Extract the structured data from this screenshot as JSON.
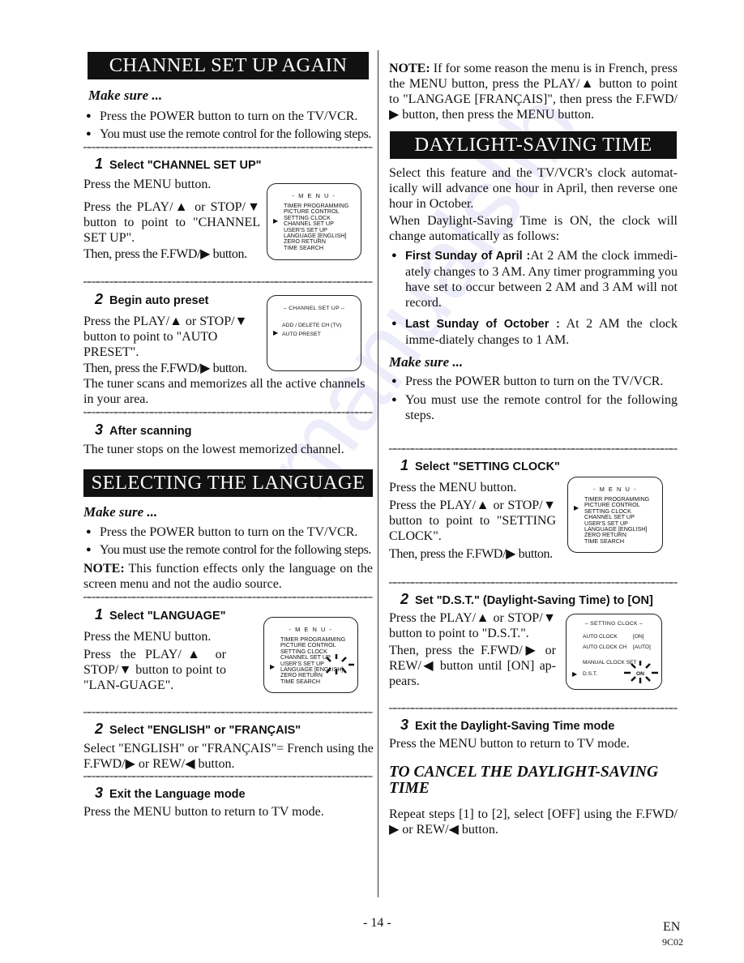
{
  "left_column": {
    "channel_setup": {
      "banner": "CHANNEL SET UP AGAIN",
      "make_sure": "Make sure ...",
      "bullets": [
        "Press the POWER button to turn on the TV/VCR.",
        "You must use the remote control for the following steps."
      ],
      "step1": {
        "number": "1",
        "title": "Select \"CHANNEL SET UP\"",
        "lines": [
          "Press  the MENU button.",
          "Press the PLAY/▲ or STOP/▼ button to point to \"CHANNEL SET UP\".",
          "Then, press the F.FWD/▶ button."
        ],
        "screen": {
          "title": "- M E N U -",
          "items": [
            "TIMER PROGRAMMING",
            "PICTURE CONTROL",
            "SETTING CLOCK",
            "CHANNEL SET UP",
            "USER'S SET UP",
            "LANGUAGE  [ENGLISH]",
            "ZERO RETURN",
            "TIME SEARCH"
          ],
          "cursor": "▶",
          "selected_index": 3
        }
      },
      "step2": {
        "number": "2",
        "title": "Begin auto preset",
        "lines": [
          "Press the PLAY/▲ or STOP/▼ button to point to \"AUTO PRESET\".",
          "Then, press the F.FWD/▶ button.",
          "The tuner scans and memorizes all the active channels in your area."
        ],
        "screen": {
          "title": "– CHANNEL  SET  UP –",
          "items": [
            "ADD / DELETE CH (TV)",
            "AUTO PRESET"
          ],
          "cursor": "▶",
          "selected_index": 1
        }
      },
      "step3": {
        "number": "3",
        "title": "After scanning",
        "text": "The tuner stops on the lowest memorized channel."
      }
    },
    "language": {
      "banner": "SELECTING THE LANGUAGE",
      "make_sure": "Make sure ...",
      "bullets": [
        "Press the POWER button to turn on the TV/VCR.",
        "You must use the remote control for the following steps."
      ],
      "note_label": "NOTE:",
      "note_text": " This function effects only the language on the screen menu and not the audio source.",
      "step1": {
        "number": "1",
        "title": "Select \"LANGUAGE\"",
        "lines": [
          "Press the MENU button.",
          "Press the PLAY/▲ or STOP/▼ button to point to \"LAN-GUAGE\"."
        ],
        "screen": {
          "title": "- M E N U -",
          "items": [
            "TIMER PROGRAMMING",
            "PICTURE CONTROL",
            "SETTING CLOCK",
            "CHANNEL SET UP",
            "USER'S SET UP",
            "LANGUAGE  [ENGLISH]",
            "ZERO RETURN",
            "TIME SEARCH"
          ],
          "cursor": "▶",
          "selected_index": 5
        }
      },
      "step2": {
        "number": "2",
        "title": "Select \"ENGLISH\" or \"FRANÇAIS\"",
        "text": "Select \"ENGLISH\" or \"FRANÇAIS\"= French using the F.FWD/▶ or REW/◀ button."
      },
      "step3": {
        "number": "3",
        "title": "Exit the Language mode",
        "text": "Press the MENU button to return to TV mode."
      }
    }
  },
  "right_column": {
    "french_note": {
      "label": "NOTE:",
      "text": " If for some reason the menu is in French, press the MENU button, press the PLAY/▲ button to point to \"LANGAGE [FRANÇAIS]\", then press the F.FWD/ ▶ button, then press the MENU button."
    },
    "dst": {
      "banner": "DAYLIGHT-SAVING TIME",
      "intro": "Select this feature and the TV/VCR's clock automat-ically will advance one hour in April, then reverse one hour in October.",
      "when_on": "When Daylight-Saving Time is ON, the clock will change automatically as follows:",
      "rules": [
        {
          "label": "First Sunday of April :",
          "text": "At 2 AM the clock immedi-ately changes to 3 AM. Any timer programming you have set to occur between 2 AM and 3 AM will not record."
        },
        {
          "label": "Last Sunday of October :",
          "text": " At 2 AM the clock imme-diately changes to 1 AM."
        }
      ],
      "make_sure": "Make sure ...",
      "bullets": [
        "Press the POWER button to turn on the TV/VCR.",
        "You must use the remote control for the following steps."
      ],
      "step1": {
        "number": "1",
        "title": "Select \"SETTING CLOCK\"",
        "lines": [
          "Press the MENU button.",
          "Press the PLAY/▲ or STOP/▼ button to point to \"SETTING CLOCK\".",
          "Then, press the F.FWD/▶ button."
        ],
        "screen": {
          "title": "- M E N U -",
          "items": [
            "TIMER PROGRAMMING",
            "PICTURE CONTROL",
            "SETTING CLOCK",
            "CHANNEL SET UP",
            "USER'S SET UP",
            "LANGUAGE  [ENGLISH]",
            "ZERO RETURN",
            "TIME SEARCH"
          ],
          "cursor": "▶",
          "selected_index": 2
        }
      },
      "step2": {
        "number": "2",
        "title": "Set \"D.S.T.\" (Daylight-Saving Time) to [ON]",
        "lines": [
          "Press the PLAY/▲ or STOP/▼ button to point to \"D.S.T.\".",
          "Then, press the F.FWD/▶ or REW/◀ button until [ON] ap-pears."
        ],
        "screen": {
          "title": "– SETTING CLOCK –",
          "rows": [
            {
              "label": "AUTO CLOCK",
              "value": "[ON]"
            },
            {
              "label": "AUTO CLOCK CH",
              "value": "[AUTO]"
            },
            {
              "label": "MANUAL CLOCK SET",
              "value": ""
            },
            {
              "label": "D.S.T.",
              "value": "ON"
            }
          ],
          "cursor": "▶",
          "selected_index": 3
        }
      },
      "step3": {
        "number": "3",
        "title": "Exit the Daylight-Saving Time mode",
        "text": "Press the MENU button to return to TV mode."
      },
      "cancel_title": "TO CANCEL THE DAYLIGHT-SAVING TIME",
      "cancel_text": "Repeat steps [1] to [2], select [OFF] using  the F.FWD/▶ or REW/◀ button."
    }
  },
  "footer": {
    "page_number": "- 14 -",
    "language_code": "EN",
    "doc_code": "9C02"
  }
}
